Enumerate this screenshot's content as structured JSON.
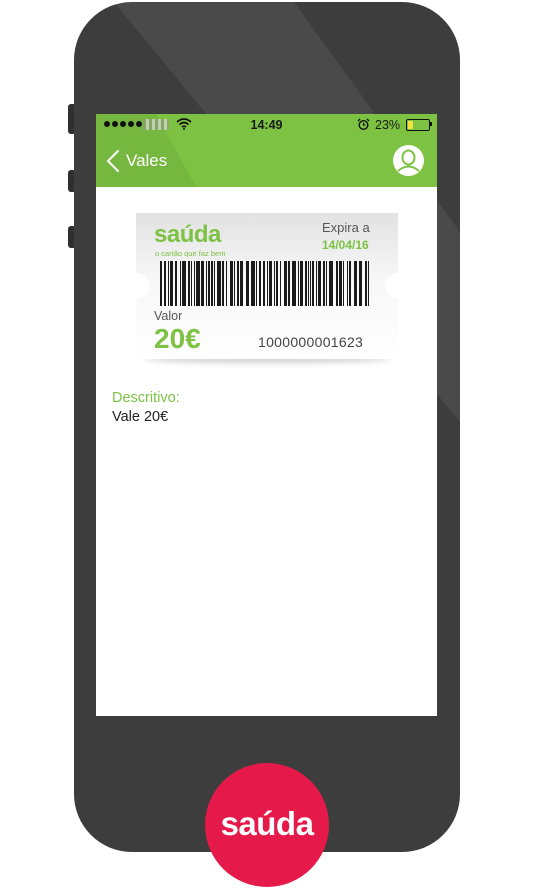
{
  "status_bar": {
    "time": "14:49",
    "battery_percent": "23%",
    "battery_level": 0.23
  },
  "nav": {
    "back_label": "Vales"
  },
  "voucher": {
    "brand": "saúda",
    "tagline": "o cartão que faz bem",
    "expira_label": "Expira a",
    "expira_date": "14/04/16",
    "valor_label": "Valor",
    "valor_amount": "20€",
    "code": "1000000001623"
  },
  "details": {
    "descritivo_label": "Descritivo:",
    "descritivo_value": "Vale 20€"
  },
  "logo": {
    "text": "saúda"
  },
  "colors": {
    "brand_green": "#7dc243",
    "brand_red": "#e5194a",
    "phone_body": "#3d3d3d"
  }
}
